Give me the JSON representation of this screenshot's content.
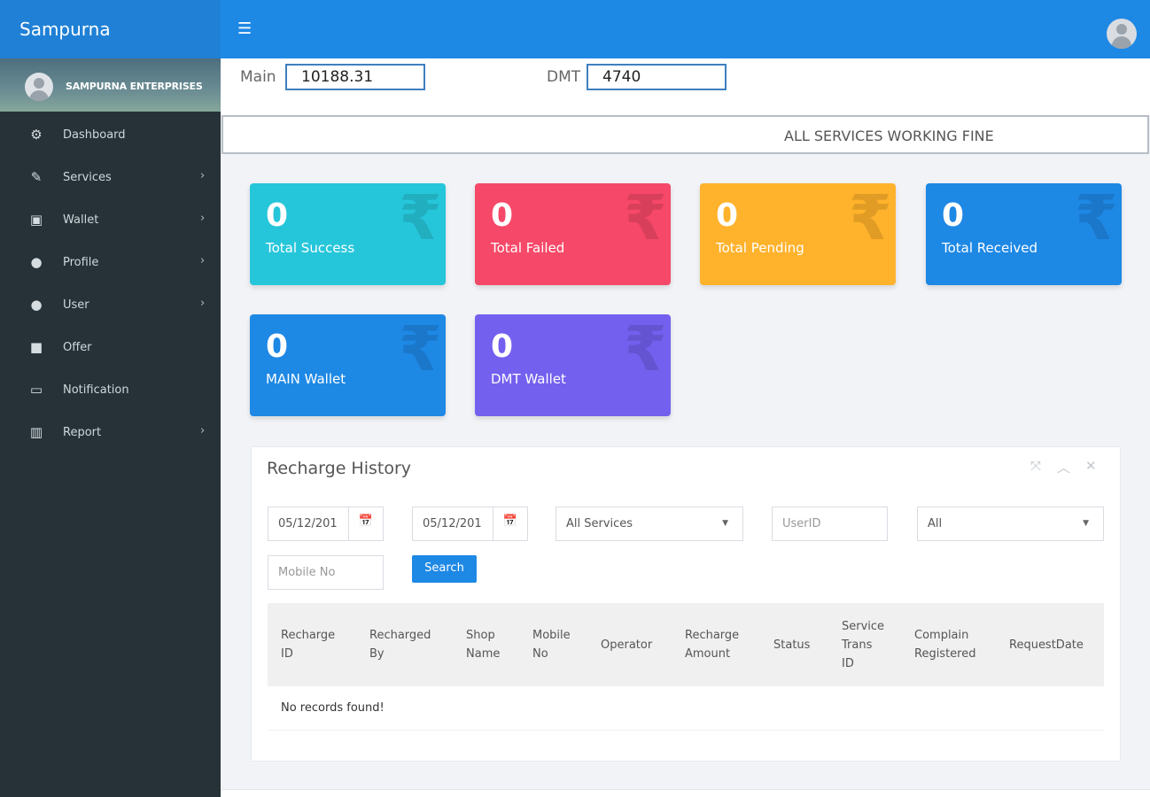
{
  "app": {
    "brand": "Sampurna",
    "menu_icon": "hamburger-icon",
    "profile_icon": "user-avatar-icon"
  },
  "sidebar": {
    "user_name": "SAMPURNA ENTERPRISES",
    "items": [
      {
        "label": "Dashboard",
        "icon": "dashboard-icon",
        "glyph": "⚙",
        "has_submenu": false
      },
      {
        "label": "Services",
        "icon": "edit-icon",
        "glyph": "✎",
        "has_submenu": true
      },
      {
        "label": "Wallet",
        "icon": "briefcase-icon",
        "glyph": "▣",
        "has_submenu": true
      },
      {
        "label": "Profile",
        "icon": "user-icon",
        "glyph": "●",
        "has_submenu": true
      },
      {
        "label": "User",
        "icon": "user-icon",
        "glyph": "●",
        "has_submenu": true
      },
      {
        "label": "Offer",
        "icon": "gift-icon",
        "glyph": "■",
        "has_submenu": false
      },
      {
        "label": "Notification",
        "icon": "inbox-icon",
        "glyph": "▭",
        "has_submenu": false
      },
      {
        "label": "Report",
        "icon": "bar-chart-icon",
        "glyph": "▥",
        "has_submenu": true
      }
    ],
    "chevron": "›"
  },
  "balances": {
    "main_label": "Main",
    "main_value": "10188.31",
    "dmt_label": "DMT",
    "dmt_value": "4740"
  },
  "status_message": "ALL SERVICES WORKING FINE",
  "cards": [
    {
      "value": "0",
      "label": "Total Success",
      "color": "#26c6da"
    },
    {
      "value": "0",
      "label": "Total Failed",
      "color": "#f64868"
    },
    {
      "value": "0",
      "label": "Total Pending",
      "color": "#ffb22b"
    },
    {
      "value": "0",
      "label": "Total Received",
      "color": "#1e88e5"
    },
    {
      "value": "0",
      "label": "MAIN Wallet",
      "color": "#1e88e5"
    },
    {
      "value": "0",
      "label": "DMT Wallet",
      "color": "#7460ee"
    }
  ],
  "card_icon": "₹",
  "recharge_history": {
    "title": "Recharge History",
    "tools": [
      "⤧",
      "︿",
      "✕"
    ],
    "filters": {
      "from_date": "05/12/201",
      "to_date": "05/12/201",
      "calendar_icon": "📅",
      "services_select": "All Services",
      "userid_placeholder": "UserID",
      "status_select": "All",
      "mobile_placeholder": "Mobile No",
      "search_label": "Search"
    },
    "columns": [
      [
        "Recharge",
        "ID"
      ],
      [
        "Recharged",
        "By"
      ],
      [
        "Shop",
        "Name"
      ],
      [
        "Mobile",
        "No"
      ],
      [
        "Operator"
      ],
      [
        "Recharge",
        "Amount"
      ],
      [
        "Status"
      ],
      [
        "Service",
        "Trans",
        "ID"
      ],
      [
        "Complain",
        "Registered"
      ],
      [
        "RequestDate"
      ]
    ],
    "empty_message": "No records found!"
  },
  "colors": {
    "topbar": "#1e88e5",
    "sidebar": "#263238",
    "accent": "#1e88e5"
  }
}
